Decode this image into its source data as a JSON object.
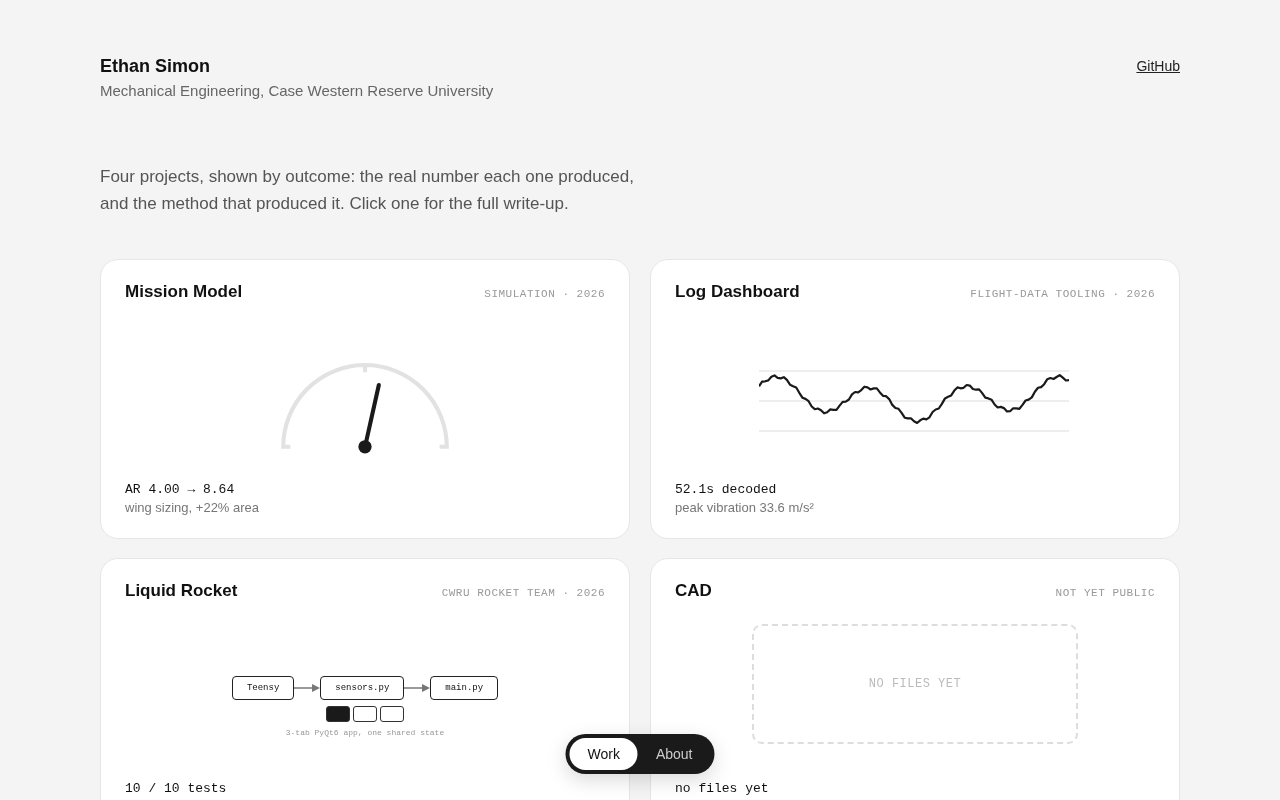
{
  "header": {
    "name": "Ethan Simon",
    "affiliation": "Mechanical Engineering, Case Western Reserve University",
    "link": "GitHub"
  },
  "intro": "Four projects, shown by outcome: the real number each one produced, and the method that produced it. Click one for the full write-up.",
  "projects": [
    {
      "kind": "gauge",
      "title": "Mission Model",
      "meta": "SIMULATION · 2026",
      "level": 0.57,
      "metric": "AR 4.00 → 8.64",
      "detail": "wing sizing, +22% area"
    },
    {
      "kind": "waveform",
      "title": "Log Dashboard",
      "meta": "FLIGHT-DATA TOOLING · 2026",
      "metric": "52.1s decoded",
      "detail": "peak vibration 33.6 m/s²"
    },
    {
      "kind": "diagram",
      "title": "Liquid Rocket",
      "meta": "CWRU ROCKET TEAM · 2026",
      "nodes": [
        "Teensy",
        "sensors.py",
        "main.py"
      ],
      "tabs": [
        {
          "selected": true
        },
        {
          "selected": false
        },
        {
          "selected": false
        }
      ],
      "caption": "3-tab PyQt6 app, one shared state",
      "metric": "10 / 10 tests"
    },
    {
      "kind": "placeholder",
      "title": "CAD",
      "meta": "NOT YET PUBLIC",
      "placeholder": "NO FILES YET",
      "metric": "no files yet"
    }
  ],
  "nav": [
    {
      "label": "Work",
      "selected": true
    },
    {
      "label": "About",
      "selected": false
    }
  ]
}
